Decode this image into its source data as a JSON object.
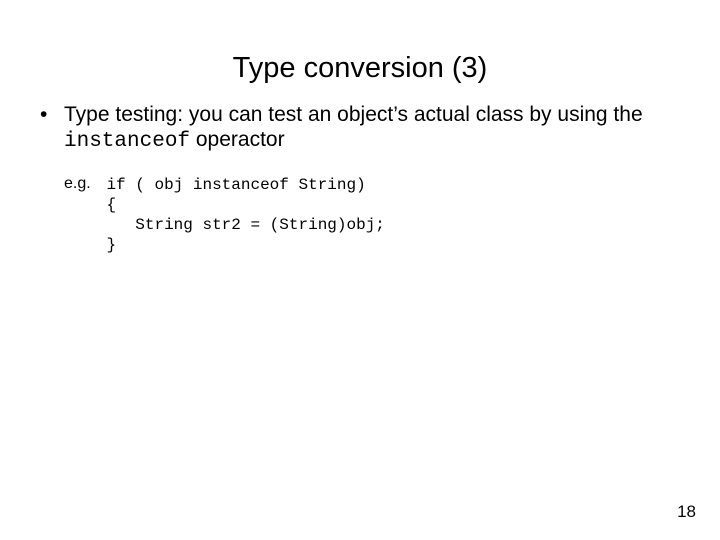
{
  "title": "Type conversion (3)",
  "bullet": {
    "pre": "Type testing: you can test an object’s actual class by using the ",
    "code": "instanceof",
    "post": " operactor"
  },
  "example": {
    "label": "e.g.",
    "code": "if ( obj instanceof String)\n{\n   String str2 = (String)obj;\n}"
  },
  "pageNumber": "18"
}
